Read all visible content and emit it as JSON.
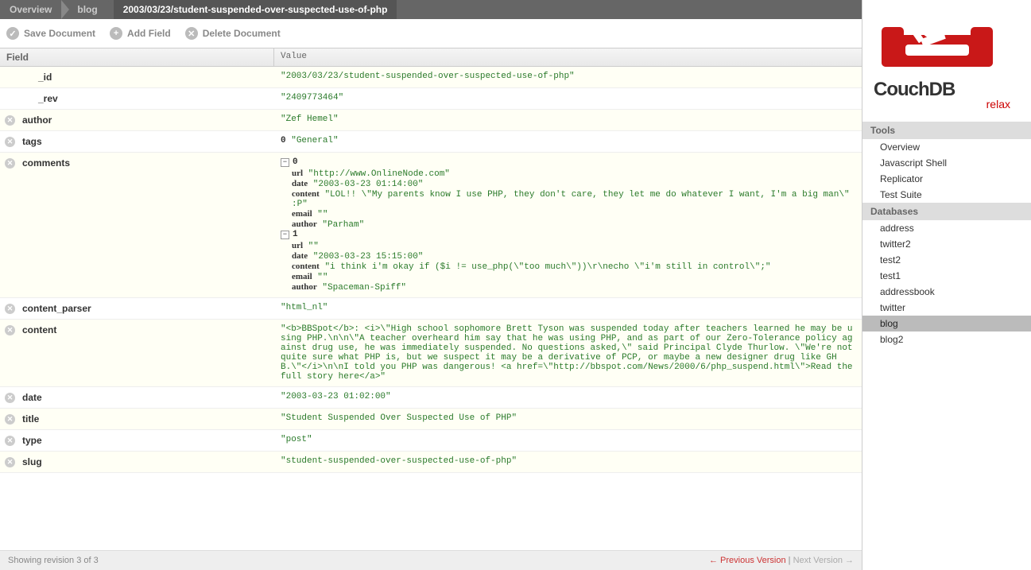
{
  "breadcrumb": {
    "overview": "Overview",
    "db": "blog",
    "doc": "2003/03/23/student-suspended-over-suspected-use-of-php"
  },
  "toolbar": {
    "save": "Save Document",
    "add": "Add Field",
    "delete": "Delete Document"
  },
  "headers": {
    "field": "Field",
    "value": "Value"
  },
  "fields": {
    "id": {
      "name": "_id",
      "value": "\"2003/03/23/student-suspended-over-suspected-use-of-php\""
    },
    "rev": {
      "name": "_rev",
      "value": "\"2409773464\""
    },
    "author": {
      "name": "author",
      "value": "\"Zef Hemel\""
    },
    "tags": {
      "name": "tags",
      "idx0": "0",
      "val0": "\"General\""
    },
    "comments": {
      "name": "comments",
      "items": [
        {
          "idx": "0",
          "url": "\"http://www.OnlineNode.com\"",
          "date": "\"2003-03-23 01:14:00\"",
          "content": "\"LOL!! \\\"My parents know I use PHP, they don't care, they let me do whatever I want, I'm a big man\\\" :P\"",
          "email": "\"\"",
          "author": "\"Parham\""
        },
        {
          "idx": "1",
          "url": "\"\"",
          "date": "\"2003-03-23 15:15:00\"",
          "content": "\"i think i'm okay if ($i != use_php(\\\"too much\\\"))\\r\\necho \\\"i'm still in control\\\";\"",
          "email": "\"\"",
          "author": "\"Spaceman-Spiff\""
        }
      ],
      "labels": {
        "url": "url",
        "date": "date",
        "content": "content",
        "email": "email",
        "author": "author"
      }
    },
    "content_parser": {
      "name": "content_parser",
      "value": "\"html_nl\""
    },
    "content": {
      "name": "content",
      "value": "\"<b>BBSpot</b>: <i>\\\"High school sophomore Brett Tyson was suspended today after teachers learned he may be using PHP.\\n\\n\\\"A teacher overheard him say that he was using PHP, and as part of our Zero-Tolerance policy against drug use, he was immediately suspended. No questions asked,\\\" said Principal Clyde Thurlow. \\\"We're not quite sure what PHP is, but we suspect it may be a derivative of PCP, or maybe a new designer drug like GHB.\\\"</i>\\n\\nI told you PHP was dangerous! <a href=\\\"http://bbspot.com/News/2000/6/php_suspend.html\\\">Read the full story here</a>\""
    },
    "date": {
      "name": "date",
      "value": "\"2003-03-23 01:02:00\""
    },
    "title": {
      "name": "title",
      "value": "\"Student Suspended Over Suspected Use of PHP\""
    },
    "type": {
      "name": "type",
      "value": "\"post\""
    },
    "slug": {
      "name": "slug",
      "value": "\"student-suspended-over-suspected-use-of-php\""
    }
  },
  "footer": {
    "showing": "Showing revision 3 of 3",
    "prev": "← Previous Version",
    "sep": " | ",
    "next": "Next Version →"
  },
  "brand": {
    "name": "CouchDB",
    "sub": "relax"
  },
  "sidebar": {
    "tools_h": "Tools",
    "tools": [
      "Overview",
      "Javascript Shell",
      "Replicator",
      "Test Suite"
    ],
    "db_h": "Databases",
    "dbs": [
      "address",
      "twitter2",
      "test2",
      "test1",
      "addressbook",
      "twitter",
      "blog",
      "blog2"
    ],
    "selected_db": "blog"
  }
}
